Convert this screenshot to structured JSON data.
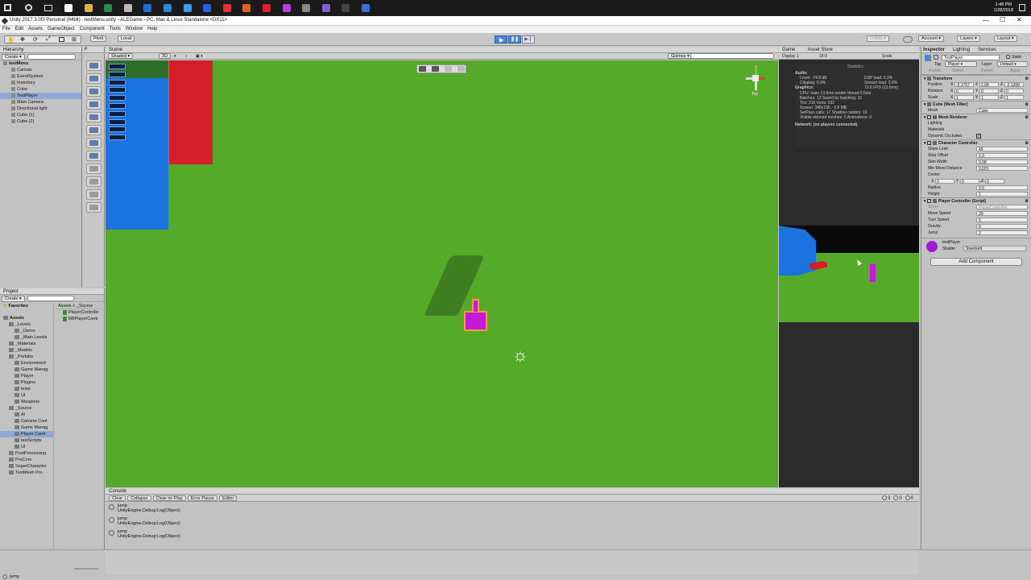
{
  "taskbar": {
    "time": "1:48 PM",
    "date": "1/28/2018"
  },
  "window": {
    "title": "Unity 2017.3.0f3 Personal (64bit) - testMenu.unity - ALEGame - PC, Mac & Linux Standalone <DX11>"
  },
  "menubar": [
    "File",
    "Edit",
    "Assets",
    "GameObject",
    "Component",
    "Tools",
    "Window",
    "Help"
  ],
  "toolbar": {
    "pivot": "Pivot",
    "local": "Local",
    "collab": "Collab",
    "account": "Account",
    "layers": "Layers",
    "layout": "Layout"
  },
  "hierarchy": {
    "tab": "Hierarchy",
    "create": "Create",
    "items": [
      {
        "label": "testMenu",
        "indent": 0,
        "bold": true,
        "selected": false
      },
      {
        "label": "Canvas",
        "indent": 1,
        "bold": false,
        "selected": false
      },
      {
        "label": "EventSystem",
        "indent": 1,
        "bold": false,
        "selected": false
      },
      {
        "label": "Inventory",
        "indent": 1,
        "bold": false,
        "selected": false
      },
      {
        "label": "Cube",
        "indent": 1,
        "bold": false,
        "selected": false
      },
      {
        "label": "TestPlayer",
        "indent": 1,
        "bold": false,
        "selected": true
      },
      {
        "label": "Main Camera",
        "indent": 1,
        "bold": false,
        "selected": false
      },
      {
        "label": "Directional light",
        "indent": 1,
        "bold": false,
        "selected": false
      },
      {
        "label": "Cube (1)",
        "indent": 1,
        "bold": false,
        "selected": false
      },
      {
        "label": "Cube (2)",
        "indent": 1,
        "bold": false,
        "selected": false
      }
    ]
  },
  "scene": {
    "tab": "Scene",
    "shading": "Shaded",
    "mode": "2D",
    "gizmos": "Gizmos",
    "persp": "Top",
    "toolbar_icons": [
      "camera-icon",
      "move-icon",
      "cursor-icon",
      "hand-icon"
    ]
  },
  "tools": [
    "cube-icon",
    "sphere-icon",
    "capsule-icon",
    "cylinder-icon",
    "plane-icon",
    "light-icon",
    "camera-icon",
    "terrain-icon",
    "wind-icon",
    "particles-icon",
    "audio-icon",
    "ui-icon"
  ],
  "game": {
    "tab": "Game",
    "assetstore": "Asset Store",
    "display": "Display 1",
    "aspect": "16:9",
    "scale": "Scale"
  },
  "stats": {
    "title": "Statistics",
    "audio_label": "Audio:",
    "audio": [
      "Level: -74.8 dB",
      "Clipping: 0.0%",
      "DSP load: 0.3%",
      "Stream load: 0.0%"
    ],
    "graphics_label": "Graphics:",
    "fps": "73.6 FPS (13.6ms)",
    "graphics": [
      "CPU: main 13.6ms  render thread 0.5ms",
      "Batches: 12   Saved by batching: 31",
      "Tris: 316  Verts: 632",
      "Screen: 348x195 - 0.8 MB",
      "SetPass calls: 17  Shadow casters: 16",
      "Visible skinned meshes: 0  Animations: 0"
    ],
    "network": "Network: (no players connected)"
  },
  "inspector": {
    "tabs": [
      "Inspector",
      "Lighting",
      "Services"
    ],
    "name": "TestPlayer",
    "static": "Static",
    "tag_label": "Tag",
    "tag": "Player",
    "layer_label": "Layer",
    "layer": "Default",
    "prefab_label": "Prefab",
    "prefab_buttons": [
      "Select",
      "Revert",
      "Apply"
    ],
    "transform": {
      "title": "Transform",
      "rows": [
        {
          "label": "Position",
          "x": "-0.1757",
          "y": "2.08",
          "z": "-2.1208"
        },
        {
          "label": "Rotation",
          "x": "0",
          "y": "0",
          "z": "0"
        },
        {
          "label": "Scale",
          "x": "1",
          "y": "1",
          "z": "1"
        }
      ]
    },
    "meshfilter": {
      "title": "Cube (Mesh Filter)",
      "mesh_label": "Mesh",
      "mesh": "Cube"
    },
    "renderer": {
      "title": "Mesh Renderer",
      "rows": [
        "Lighting",
        "Materials"
      ],
      "occluded": "Dynamic Occluded"
    },
    "charctrl": {
      "title": "Character Controller",
      "rows": [
        {
          "label": "Slope Limit",
          "value": "45"
        },
        {
          "label": "Step Offset",
          "value": "0.3"
        },
        {
          "label": "Skin Width",
          "value": "0.08"
        },
        {
          "label": "Min Move Distance",
          "value": "0.001"
        }
      ],
      "center_label": "Center",
      "center": {
        "x": "0",
        "y": "0",
        "z": "0"
      },
      "rows2": [
        {
          "label": "Radius",
          "value": "0.5"
        },
        {
          "label": "Height",
          "value": "1"
        }
      ]
    },
    "playerctrl": {
      "title": "Player Controller (Script)",
      "script_label": "Script",
      "script": "PlayerController",
      "rows": [
        {
          "label": "Move Speed",
          "value": "20"
        },
        {
          "label": "Turn Speed",
          "value": "5"
        },
        {
          "label": "Gravity",
          "value": "6"
        },
        {
          "label": "Jump",
          "value": "2"
        }
      ]
    },
    "material": {
      "name": "testPlayer",
      "shader_label": "Shader",
      "shader": "Standard"
    },
    "add": "Add Component"
  },
  "project": {
    "tab": "Project",
    "create": "Create",
    "favorites": "Favorites",
    "breadcrumb": "Assets > _Source",
    "files": [
      "PlayerControlle",
      "RBPlayerContr"
    ],
    "tree": [
      {
        "label": "Assets",
        "indent": 0,
        "bold": true,
        "sel": false
      },
      {
        "label": "_Levels",
        "indent": 1,
        "bold": false,
        "sel": false
      },
      {
        "label": "_Demo",
        "indent": 2,
        "bold": false,
        "sel": false
      },
      {
        "label": "_Main Levels",
        "indent": 2,
        "bold": false,
        "sel": false
      },
      {
        "label": "_Materials",
        "indent": 1,
        "bold": false,
        "sel": false
      },
      {
        "label": "_Models",
        "indent": 1,
        "bold": false,
        "sel": false
      },
      {
        "label": "_Prefabs",
        "indent": 1,
        "bold": false,
        "sel": false
      },
      {
        "label": "Environment",
        "indent": 2,
        "bold": false,
        "sel": false
      },
      {
        "label": "Game Manag",
        "indent": 2,
        "bold": false,
        "sel": false
      },
      {
        "label": "Player",
        "indent": 2,
        "bold": false,
        "sel": false
      },
      {
        "label": "Plugins",
        "indent": 2,
        "bold": false,
        "sel": false
      },
      {
        "label": "tests",
        "indent": 2,
        "bold": false,
        "sel": false
      },
      {
        "label": "UI",
        "indent": 2,
        "bold": false,
        "sel": false
      },
      {
        "label": "Weapons",
        "indent": 2,
        "bold": false,
        "sel": false
      },
      {
        "label": "_Source",
        "indent": 1,
        "bold": false,
        "sel": false
      },
      {
        "label": "AI",
        "indent": 2,
        "bold": false,
        "sel": false
      },
      {
        "label": "Camera Cont",
        "indent": 2,
        "bold": false,
        "sel": false
      },
      {
        "label": "Game Manag",
        "indent": 2,
        "bold": false,
        "sel": false
      },
      {
        "label": "Player Contr",
        "indent": 2,
        "bold": false,
        "sel": true
      },
      {
        "label": "testScripts",
        "indent": 2,
        "bold": false,
        "sel": false
      },
      {
        "label": "UI",
        "indent": 2,
        "bold": false,
        "sel": false
      },
      {
        "label": "PostProcessing",
        "indent": 1,
        "bold": false,
        "sel": false
      },
      {
        "label": "ProCore",
        "indent": 1,
        "bold": false,
        "sel": false
      },
      {
        "label": "SuperCharacter",
        "indent": 1,
        "bold": false,
        "sel": false
      },
      {
        "label": "TextMesh Pro",
        "indent": 1,
        "bold": false,
        "sel": false
      }
    ]
  },
  "console": {
    "tab": "Console",
    "buttons": [
      "Clear",
      "Collapse",
      "Clear on Play",
      "Error Pause",
      "Editor"
    ],
    "counts": [
      "3",
      "0",
      "0"
    ],
    "entries": [
      {
        "line1": "jump",
        "line2": "UnityEngine.Debug:Log(Object)"
      },
      {
        "line1": "jump",
        "line2": "UnityEngine.Debug:Log(Object)"
      },
      {
        "line1": "jump",
        "line2": "UnityEngine.Debug:Log(Object)"
      }
    ]
  },
  "status": "jump",
  "colors": {
    "ground": "#56aa2a",
    "blue": "#1b73e0",
    "red": "#d41e2a",
    "player": "#c21ad8"
  }
}
